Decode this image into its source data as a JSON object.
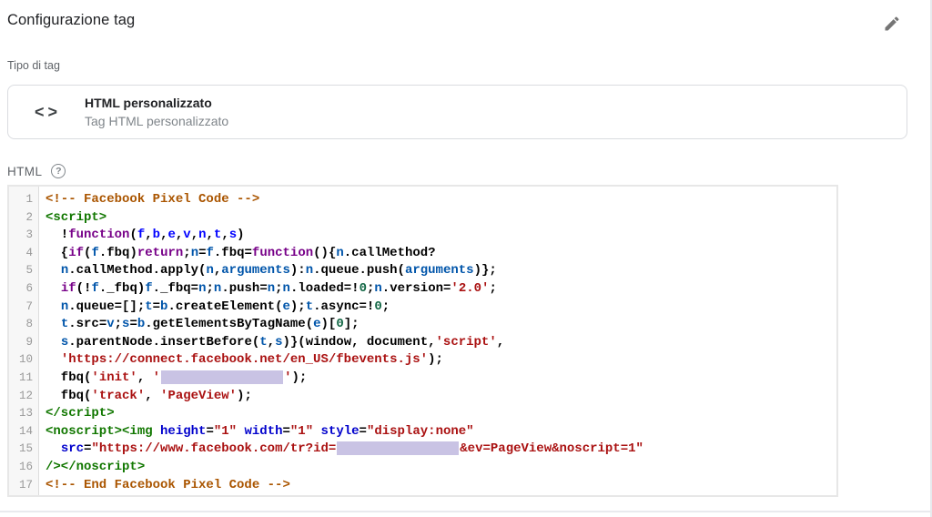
{
  "page": {
    "title": "Configurazione tag"
  },
  "header": {
    "edit_icon": "pencil-icon"
  },
  "tag_type": {
    "label": "Tipo di tag",
    "card": {
      "icon": "code-brackets-icon",
      "icon_left": "<",
      "icon_right": ">",
      "title": "HTML personalizzato",
      "subtitle": "Tag HTML personalizzato"
    }
  },
  "html_editor": {
    "label": "HTML",
    "help_glyph": "?",
    "syntax_colors": {
      "comment": "#a50",
      "tag": "#170",
      "attribute": "#00c",
      "string": "#a11",
      "keyword": "#708",
      "variable": "#05a",
      "def": "#00f",
      "number": "#164",
      "plain": "#000",
      "line_number": "#999",
      "redaction": "#c9c3e4"
    },
    "lines": [
      {
        "num": 1,
        "tokens": [
          [
            "c",
            "<!-- Facebook Pixel Code -->"
          ]
        ]
      },
      {
        "num": 2,
        "tokens": [
          [
            "t",
            "<script>"
          ]
        ]
      },
      {
        "num": 3,
        "tokens": [
          [
            "p",
            "  !"
          ],
          [
            "k",
            "function"
          ],
          [
            "p",
            "("
          ],
          [
            "d",
            "f"
          ],
          [
            "p",
            ","
          ],
          [
            "d",
            "b"
          ],
          [
            "p",
            ","
          ],
          [
            "d",
            "e"
          ],
          [
            "p",
            ","
          ],
          [
            "d",
            "v"
          ],
          [
            "p",
            ","
          ],
          [
            "d",
            "n"
          ],
          [
            "p",
            ","
          ],
          [
            "d",
            "t"
          ],
          [
            "p",
            ","
          ],
          [
            "d",
            "s"
          ],
          [
            "p",
            ")"
          ]
        ]
      },
      {
        "num": 4,
        "tokens": [
          [
            "p",
            "  {"
          ],
          [
            "k",
            "if"
          ],
          [
            "p",
            "("
          ],
          [
            "v",
            "f"
          ],
          [
            "p",
            ".fbq)"
          ],
          [
            "k",
            "return"
          ],
          [
            "p",
            ";"
          ],
          [
            "v",
            "n"
          ],
          [
            "p",
            "="
          ],
          [
            "v",
            "f"
          ],
          [
            "p",
            ".fbq="
          ],
          [
            "k",
            "function"
          ],
          [
            "p",
            "(){"
          ],
          [
            "v",
            "n"
          ],
          [
            "p",
            ".callMethod?"
          ]
        ]
      },
      {
        "num": 5,
        "tokens": [
          [
            "p",
            "  "
          ],
          [
            "v",
            "n"
          ],
          [
            "p",
            ".callMethod.apply("
          ],
          [
            "v",
            "n"
          ],
          [
            "p",
            ","
          ],
          [
            "v",
            "arguments"
          ],
          [
            "p",
            "):"
          ],
          [
            "v",
            "n"
          ],
          [
            "p",
            ".queue.push("
          ],
          [
            "v",
            "arguments"
          ],
          [
            "p",
            ")};"
          ]
        ]
      },
      {
        "num": 6,
        "tokens": [
          [
            "p",
            "  "
          ],
          [
            "k",
            "if"
          ],
          [
            "p",
            "(!"
          ],
          [
            "v",
            "f"
          ],
          [
            "p",
            "._fbq)"
          ],
          [
            "v",
            "f"
          ],
          [
            "p",
            "._fbq="
          ],
          [
            "v",
            "n"
          ],
          [
            "p",
            ";"
          ],
          [
            "v",
            "n"
          ],
          [
            "p",
            ".push="
          ],
          [
            "v",
            "n"
          ],
          [
            "p",
            ";"
          ],
          [
            "v",
            "n"
          ],
          [
            "p",
            ".loaded=!"
          ],
          [
            "num",
            "0"
          ],
          [
            "p",
            ";"
          ],
          [
            "v",
            "n"
          ],
          [
            "p",
            ".version="
          ],
          [
            "s",
            "'2.0'"
          ],
          [
            "p",
            ";"
          ]
        ]
      },
      {
        "num": 7,
        "tokens": [
          [
            "p",
            "  "
          ],
          [
            "v",
            "n"
          ],
          [
            "p",
            ".queue=[];"
          ],
          [
            "v",
            "t"
          ],
          [
            "p",
            "="
          ],
          [
            "v",
            "b"
          ],
          [
            "p",
            ".createElement("
          ],
          [
            "v",
            "e"
          ],
          [
            "p",
            ");"
          ],
          [
            "v",
            "t"
          ],
          [
            "p",
            ".async=!"
          ],
          [
            "num",
            "0"
          ],
          [
            "p",
            ";"
          ]
        ]
      },
      {
        "num": 8,
        "tokens": [
          [
            "p",
            "  "
          ],
          [
            "v",
            "t"
          ],
          [
            "p",
            ".src="
          ],
          [
            "v",
            "v"
          ],
          [
            "p",
            ";"
          ],
          [
            "v",
            "s"
          ],
          [
            "p",
            "="
          ],
          [
            "v",
            "b"
          ],
          [
            "p",
            ".getElementsByTagName("
          ],
          [
            "v",
            "e"
          ],
          [
            "p",
            ")["
          ],
          [
            "num",
            "0"
          ],
          [
            "p",
            "];"
          ]
        ]
      },
      {
        "num": 9,
        "tokens": [
          [
            "p",
            "  "
          ],
          [
            "v",
            "s"
          ],
          [
            "p",
            ".parentNode.insertBefore("
          ],
          [
            "v",
            "t"
          ],
          [
            "p",
            ","
          ],
          [
            "v",
            "s"
          ],
          [
            "p",
            ")}(window, document,"
          ],
          [
            "s",
            "'script'"
          ],
          [
            "p",
            ","
          ]
        ]
      },
      {
        "num": 10,
        "tokens": [
          [
            "p",
            "  "
          ],
          [
            "s",
            "'https://connect.facebook.net/en_US/fbevents.js'"
          ],
          [
            "p",
            ");"
          ]
        ]
      },
      {
        "num": 11,
        "tokens": [
          [
            "p",
            "  fbq("
          ],
          [
            "s",
            "'init'"
          ],
          [
            "p",
            ", "
          ],
          [
            "s",
            "'"
          ],
          [
            "r",
            ""
          ],
          [
            "s",
            "'"
          ],
          [
            "p",
            ");"
          ]
        ]
      },
      {
        "num": 12,
        "tokens": [
          [
            "p",
            "  fbq("
          ],
          [
            "s",
            "'track'"
          ],
          [
            "p",
            ", "
          ],
          [
            "s",
            "'PageView'"
          ],
          [
            "p",
            ");"
          ]
        ]
      },
      {
        "num": 13,
        "tokens": [
          [
            "t",
            "</script>"
          ]
        ]
      },
      {
        "num": 14,
        "tokens": [
          [
            "t",
            "<noscript><img"
          ],
          [
            "p",
            " "
          ],
          [
            "a",
            "height"
          ],
          [
            "p",
            "="
          ],
          [
            "s",
            "\"1\""
          ],
          [
            "p",
            " "
          ],
          [
            "a",
            "width"
          ],
          [
            "p",
            "="
          ],
          [
            "s",
            "\"1\""
          ],
          [
            "p",
            " "
          ],
          [
            "a",
            "style"
          ],
          [
            "p",
            "="
          ],
          [
            "s",
            "\"display:none\""
          ]
        ]
      },
      {
        "num": 15,
        "tokens": [
          [
            "p",
            "  "
          ],
          [
            "a",
            "src"
          ],
          [
            "p",
            "="
          ],
          [
            "s",
            "\"https://www.facebook.com/tr?id="
          ],
          [
            "r",
            ""
          ],
          [
            "s",
            "&ev=PageView&noscript=1\""
          ]
        ]
      },
      {
        "num": 16,
        "tokens": [
          [
            "t",
            "/></noscript>"
          ]
        ]
      },
      {
        "num": 17,
        "tokens": [
          [
            "c",
            "<!-- End Facebook Pixel Code -->"
          ]
        ]
      }
    ]
  }
}
